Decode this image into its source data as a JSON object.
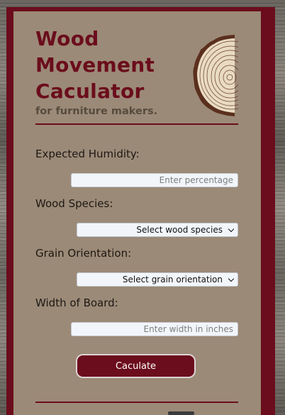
{
  "header": {
    "title_lines": [
      "Wood",
      "Movement",
      "Caculator"
    ],
    "subtitle": "for furniture makers."
  },
  "form": {
    "humidity": {
      "label": "Expected Humidity:",
      "placeholder": "Enter percentage",
      "value": ""
    },
    "species": {
      "label": "Wood Species:",
      "selected": "Select wood species"
    },
    "orientation": {
      "label": "Grain Orientation:",
      "selected": "Select grain orientation"
    },
    "width": {
      "label": "Width of Board:",
      "placeholder": "Enter width in inches",
      "value": ""
    },
    "submit_label": "Caculate"
  },
  "icons": {
    "logo": "wood-log-cross-section-icon",
    "select_arrow": "chevron-down-icon"
  },
  "colors": {
    "accent": "#6b0d1c",
    "card": "#9b8a77",
    "field": "#f2f6fb",
    "log_ring": "#5b2f1e"
  }
}
